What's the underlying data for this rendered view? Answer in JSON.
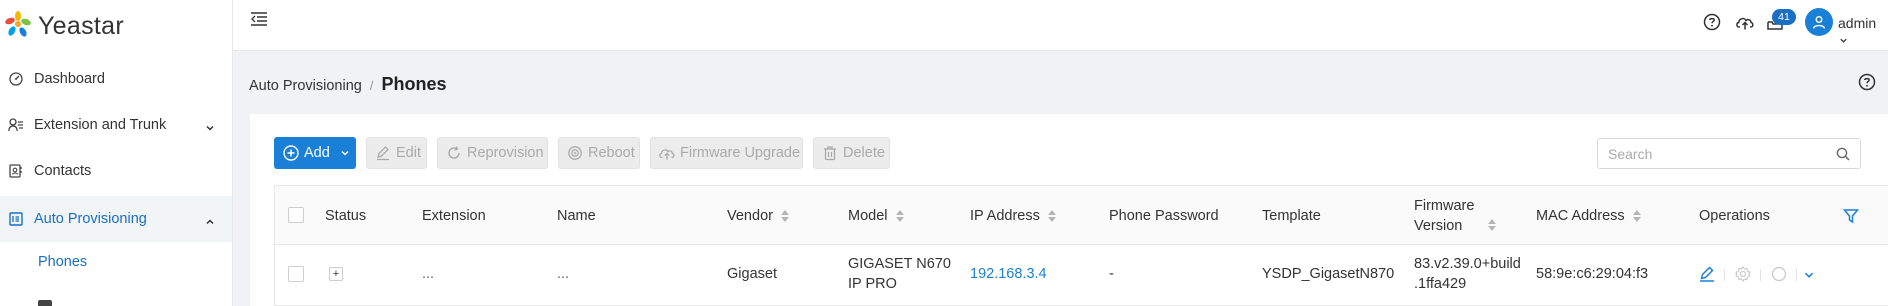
{
  "app": {
    "brand": "Yeastar",
    "accent": "#1a7fd6"
  },
  "sidebar": {
    "items": [
      {
        "label": "Dashboard",
        "icon": "dashboard-icon"
      },
      {
        "label": "Extension and Trunk",
        "icon": "users-icon",
        "expanded": false
      },
      {
        "label": "Contacts",
        "icon": "contacts-icon"
      },
      {
        "label": "Auto Provisioning",
        "icon": "auto-provisioning-icon",
        "expanded": true,
        "active": true
      }
    ],
    "sub_items": [
      {
        "label": "Phones",
        "active": true
      }
    ]
  },
  "header": {
    "notification_count": "41",
    "user_name": "admin"
  },
  "breadcrumb": {
    "parent": "Auto Provisioning",
    "separator": "/",
    "current": "Phones"
  },
  "toolbar": {
    "add": "Add",
    "edit": "Edit",
    "reprovision": "Reprovision",
    "reboot": "Reboot",
    "firmware_upgrade": "Firmware Upgrade",
    "delete": "Delete"
  },
  "search": {
    "placeholder": "Search",
    "value": ""
  },
  "table": {
    "columns": {
      "status": "Status",
      "extension": "Extension",
      "name": "Name",
      "vendor": "Vendor",
      "model": "Model",
      "ip_address": "IP Address",
      "phone_password": "Phone Password",
      "template": "Template",
      "firmware_version_1": "Firmware",
      "firmware_version_2": "Version",
      "mac_address": "MAC Address",
      "operations": "Operations"
    },
    "rows": [
      {
        "extension": "...",
        "name": "...",
        "vendor": "Gigaset",
        "model_1": "GIGASET N670",
        "model_2": "IP PRO",
        "ip_address": "192.168.3.4",
        "phone_password": "-",
        "template": "YSDP_GigasetN870",
        "firmware_1": "83.v2.39.0+build",
        "firmware_2": ".1ffa429",
        "mac_address": "58:9e:c6:29:04:f3"
      }
    ]
  }
}
